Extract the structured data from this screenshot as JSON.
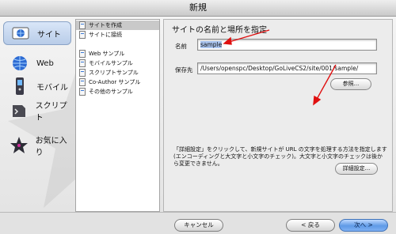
{
  "window": {
    "title": "新規"
  },
  "categories": [
    {
      "label": "サイト",
      "icon": "globe-site-icon",
      "active": true
    },
    {
      "label": "Web",
      "icon": "globe-web-icon"
    },
    {
      "label": "モバイル",
      "icon": "mobile-phone-icon"
    },
    {
      "label": "スクリプト",
      "icon": "script-icon"
    },
    {
      "label": "お気に入り",
      "icon": "favorite-star-icon"
    }
  ],
  "list": [
    {
      "label": "サイトを作成",
      "selected": true
    },
    {
      "label": "サイトに接続"
    },
    {
      "label": "Web サンプル"
    },
    {
      "label": "モバイルサンプル"
    },
    {
      "label": "スクリプトサンプル"
    },
    {
      "label": "Co-Author サンプル"
    },
    {
      "label": "その他のサンプル"
    }
  ],
  "panel": {
    "title": "サイトの名前と場所を指定",
    "name_label": "名前",
    "name_value": "sample",
    "location_label": "保存先",
    "location_value": "/Users/openspc/Desktop/GoLiveCS2/site/001/sample/",
    "browse_button": "参照...",
    "description": "「詳細設定」をクリックして、新規サイトが URL の文字を処理する方法を指定します (エンコーディングと大文字と小文字のチェック)。大文字と小文字のチェックは後から変更できません。",
    "advanced_button": "詳細設定..."
  },
  "footer": {
    "cancel": "キャンセル",
    "back": "< 戻る",
    "next": "次へ >"
  },
  "colors": {
    "arrow": "#e01010",
    "primary_button": "#5f9ae6"
  }
}
